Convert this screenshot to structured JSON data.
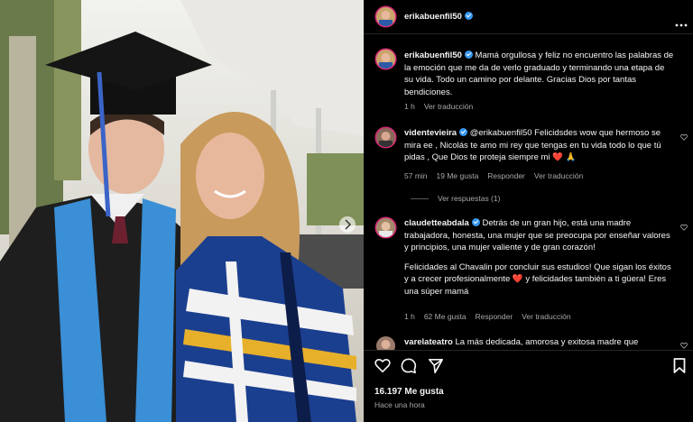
{
  "post": {
    "username": "erikabuenfil50"
  },
  "caption": {
    "username": "erikabuenfil50",
    "text": "Mamá orgullosa y feliz no encuentro las palabras de la emoción que me da de verlo graduado y terminando una etapa de su vida. Todo un camino por delante. Gracias Dios por tantas bendiciones.",
    "time": "1 h",
    "translate": "Ver traducción"
  },
  "comments": [
    {
      "username": "videntevieira",
      "text": "@erikabuenfil50 Felicidsdes wow que hermoso se mira ee , Nicolás te amo mi rey que tengas en tu vida todo lo que tú pidas , Que Dios te proteja siempre mi ❤️ 🙏",
      "time": "57 min",
      "likes": "19 Me gusta",
      "reply": "Responder",
      "translate": "Ver traducción",
      "replies": "Ver respuestas (1)"
    },
    {
      "username": "claudetteabdala",
      "text": "Detrás de un gran hijo, está una madre trabajadora, honesta, una mujer que se preocupa por enseñar valores y principios, una mujer valiente y de gran corazón!",
      "text2": "Felicidades al Chavalin por concluir sus estudios! Que sigan los éxitos y a crecer profesionalmente ❤️ y felicidades también a ti güera! Eres una súper mamá",
      "time": "1 h",
      "likes": "62 Me gusta",
      "reply": "Responder",
      "translate": "Ver traducción"
    },
    {
      "username": "varelateatro",
      "text": "La más dedicada, amorosa y exitosa madre que"
    }
  ],
  "footer": {
    "likes": "16.197 Me gusta",
    "time": "Hace una hora"
  },
  "colors": {
    "verified": "#3797f0",
    "heart": "#ff3040",
    "stole": "#3a8fd6"
  },
  "icons": [
    "more-icon",
    "heart-icon",
    "comment-icon",
    "share-icon",
    "bookmark-icon",
    "next-arrow-icon"
  ]
}
